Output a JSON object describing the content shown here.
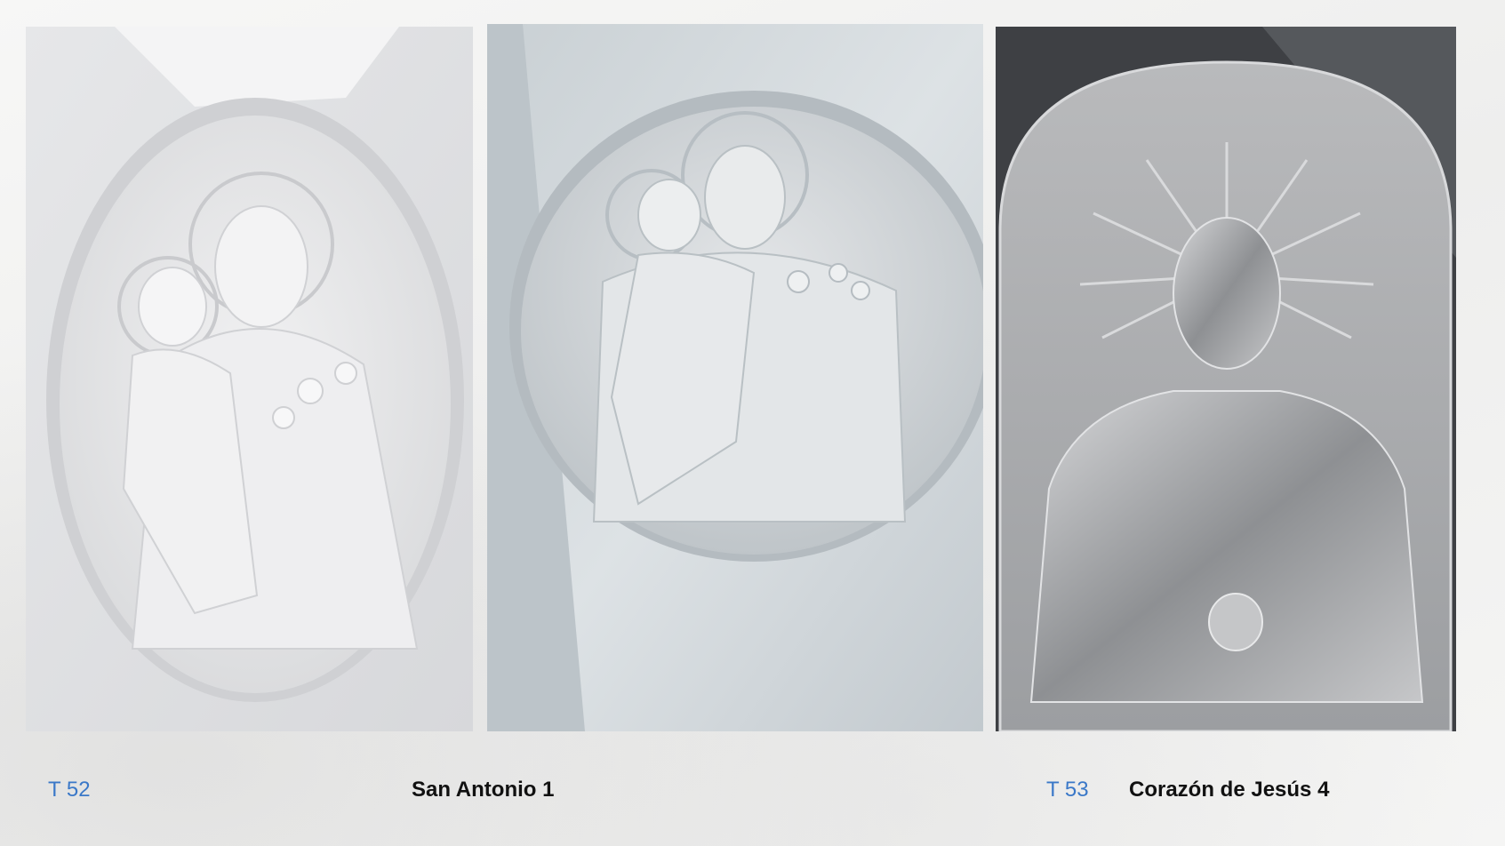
{
  "items": [
    {
      "code": "T 52",
      "title": "San Antonio  1"
    },
    {
      "code": "T 53",
      "title": "Corazón  de Jesús 4"
    }
  ],
  "colors": {
    "code_text": "#3a78c8",
    "title_text": "#111111",
    "background": "#f2f2f1"
  }
}
